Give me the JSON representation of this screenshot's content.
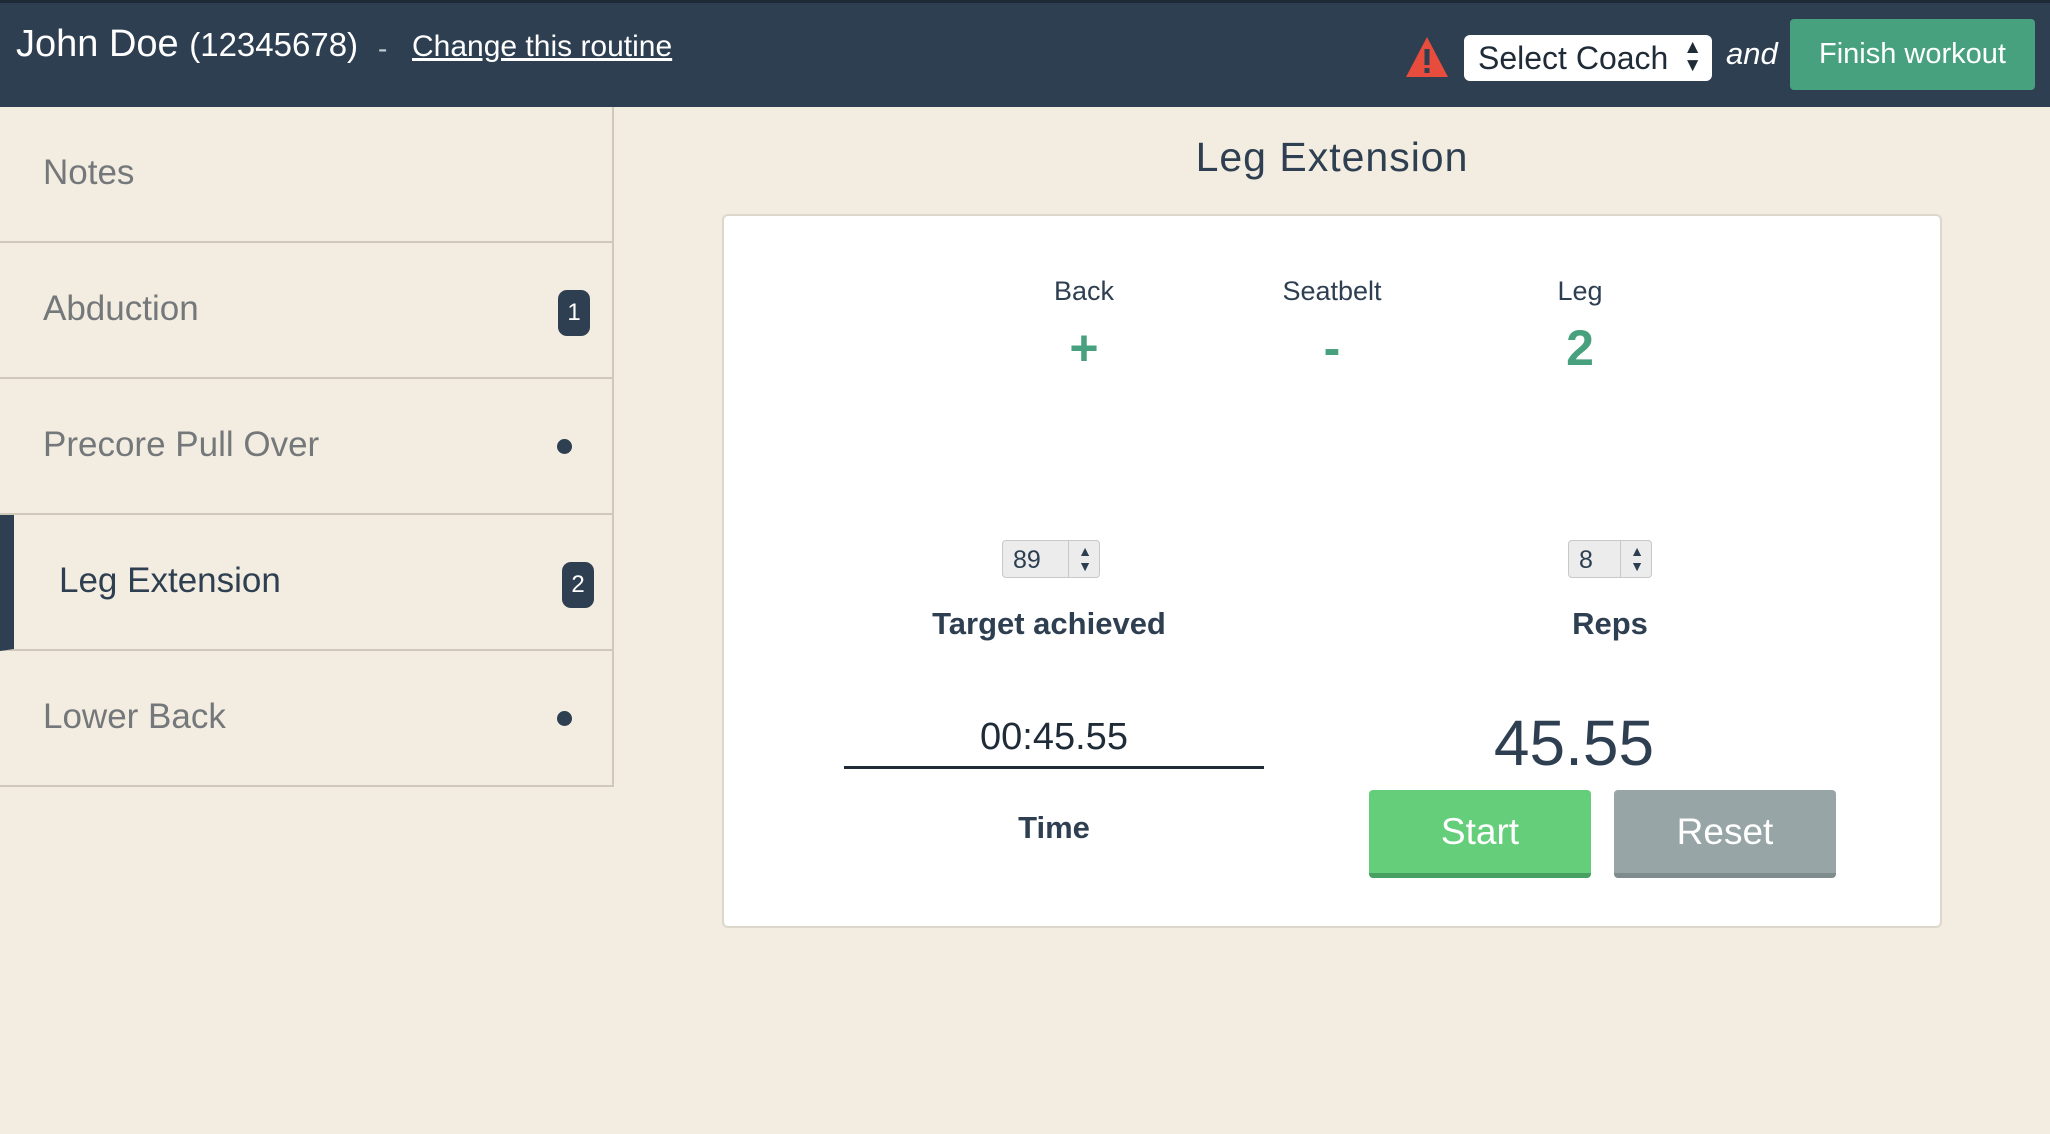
{
  "header": {
    "user_name": "John Doe",
    "user_id": "(12345678)",
    "separator": "-",
    "change_routine": "Change this routine",
    "warning_icon": "warning-triangle-icon",
    "coach_select": "Select Coach",
    "and_text": "and",
    "finish_button": "Finish workout"
  },
  "sidebar": {
    "items": [
      {
        "label": "Notes",
        "badge": null,
        "marker": null
      },
      {
        "label": "Abduction",
        "badge": "1",
        "marker": null
      },
      {
        "label": "Precore Pull Over",
        "badge": null,
        "marker": "dot"
      },
      {
        "label": "Leg Extension",
        "badge": "2",
        "marker": null,
        "active": true
      },
      {
        "label": "Lower Back",
        "badge": null,
        "marker": "dot"
      }
    ]
  },
  "main": {
    "title": "Leg Extension",
    "settings": [
      {
        "name": "Back",
        "value": "+"
      },
      {
        "name": "Seatbelt",
        "value": "-"
      },
      {
        "name": "Leg",
        "value": "2"
      }
    ],
    "target_value": "89",
    "target_label": "Target achieved",
    "reps_value": "8",
    "reps_label": "Reps",
    "time_value": "00:45.55",
    "time_label": "Time",
    "timer_display": "45.55",
    "start_button": "Start",
    "reset_button": "Reset"
  },
  "colors": {
    "header_bg": "#2e3f51",
    "page_bg": "#f2ece1",
    "accent_green": "#48a17e",
    "start_green": "#64ce7a",
    "reset_gray": "#97a5a6",
    "warning_red": "#e74c3c"
  }
}
